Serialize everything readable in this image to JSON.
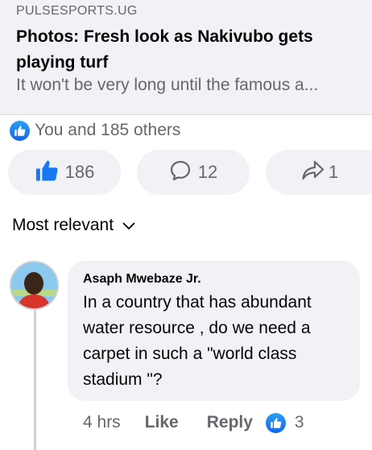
{
  "link_preview": {
    "source": "PULSESPORTS.UG",
    "title": "Photos: Fresh look as Nakivubo gets playing turf",
    "description": "It won't be very long until the famous a..."
  },
  "reactions": {
    "summary": "You and 185 others"
  },
  "actions": {
    "like_count": "186",
    "comment_count": "12",
    "share_count": "1"
  },
  "sort": {
    "label": "Most relevant"
  },
  "comment": {
    "author": "Asaph Mwebaze Jr.",
    "text": "In a country that has abundant water resource , do we need a carpet in such a \"world class stadium \"?",
    "time": "4 hrs",
    "like_label": "Like",
    "reply_label": "Reply",
    "reaction_count": "3"
  },
  "icons": {
    "reaction_badge": "thumbs-up-icon",
    "like": "thumbs-up-icon",
    "comment": "speech-bubble-icon",
    "share": "share-arrow-icon",
    "sort": "chevron-down-icon"
  },
  "colors": {
    "like_blue": "#1877f2",
    "secondary_text": "#65676b",
    "card_background": "#f0f2f5"
  }
}
